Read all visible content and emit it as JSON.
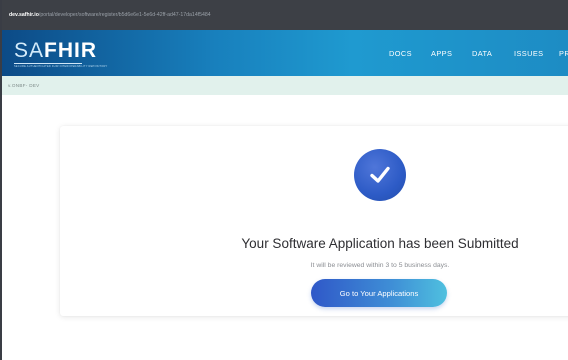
{
  "browser": {
    "url_host": "dev.safhir.io",
    "url_path": "/portal/developer/software/register/b5d6e6e1-5e6d-42ff-ad47-17da14f5484"
  },
  "header": {
    "logo_light": "SA",
    "logo_bold": "FHIR",
    "logo_tagline": "SECURE AUTHENTICATED FHIR INTEROPERABILITY REPOSITORY",
    "nav": [
      "DOCS",
      "APPS",
      "DATA",
      "ISSUES",
      "PR"
    ]
  },
  "breadcrumb": {
    "text": "v.ONBF- DEV"
  },
  "confirmation": {
    "icon": "check-icon",
    "title": "Your Software Application has been Submitted",
    "subtitle": "It will be reviewed within 3 to 5 business days.",
    "button_label": "Go to Your Applications"
  },
  "colors": {
    "header_gradient": [
      "#0c4a86",
      "#1f9ad0"
    ],
    "breadcrumb_bg": "#e1f1ec",
    "check_circle": "#2d5bc6",
    "button_gradient": [
      "#2f58c8",
      "#4fc0df"
    ]
  }
}
